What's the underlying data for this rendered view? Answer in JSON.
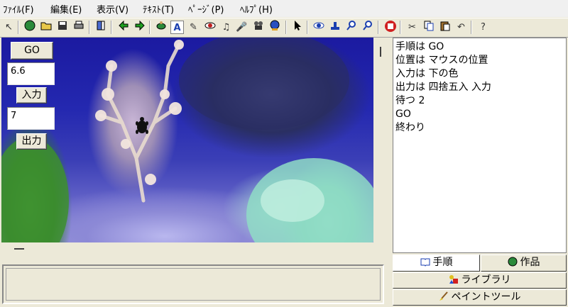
{
  "menu": [
    "ﾌｧｲﾙ(F)",
    "編集(E)",
    "表示(V)",
    "ﾃｷｽﾄ(T)",
    "ﾍﾟｰｼﾞ(P)",
    "ﾍﾙﾌﾟ(H)"
  ],
  "stage": {
    "go_label": "GO",
    "input_field_value": "6.6",
    "input_label": "入力",
    "output_field_value": "7",
    "output_label": "出力"
  },
  "editor": {
    "lines": [
      "手順は GO",
      "位置は マウスの位置",
      "入力は 下の色",
      "出力は 四捨五入 入力",
      "待つ 2",
      "GO",
      "終わり"
    ]
  },
  "tabs": {
    "steps_label": "手順",
    "works_label": "作品",
    "library_label": "ライブラリ",
    "paint_label": "ペイントツール"
  },
  "toolbar": {
    "icons": [
      "cursor-icon",
      "globe-icon",
      "open-folder-icon",
      "save-icon",
      "print-icon",
      "page-icon",
      "back-arrow-icon",
      "forward-arrow-icon",
      "turtle-icon",
      "text-box-icon",
      "brush-icon",
      "eye-icon",
      "music-icon",
      "mic-icon",
      "movie-icon",
      "globe2-icon",
      "pointer-icon",
      "view-icon",
      "stamp-icon",
      "zoom-in-icon",
      "zoom-out-icon",
      "stop-hand-icon",
      "scissors-icon",
      "copy-icon",
      "paste-icon",
      "undo-icon",
      "help-icon"
    ],
    "help_glyph": "?"
  },
  "colors": {
    "accent_tab": "#ece9d8",
    "stage_water": "#2428b0"
  }
}
